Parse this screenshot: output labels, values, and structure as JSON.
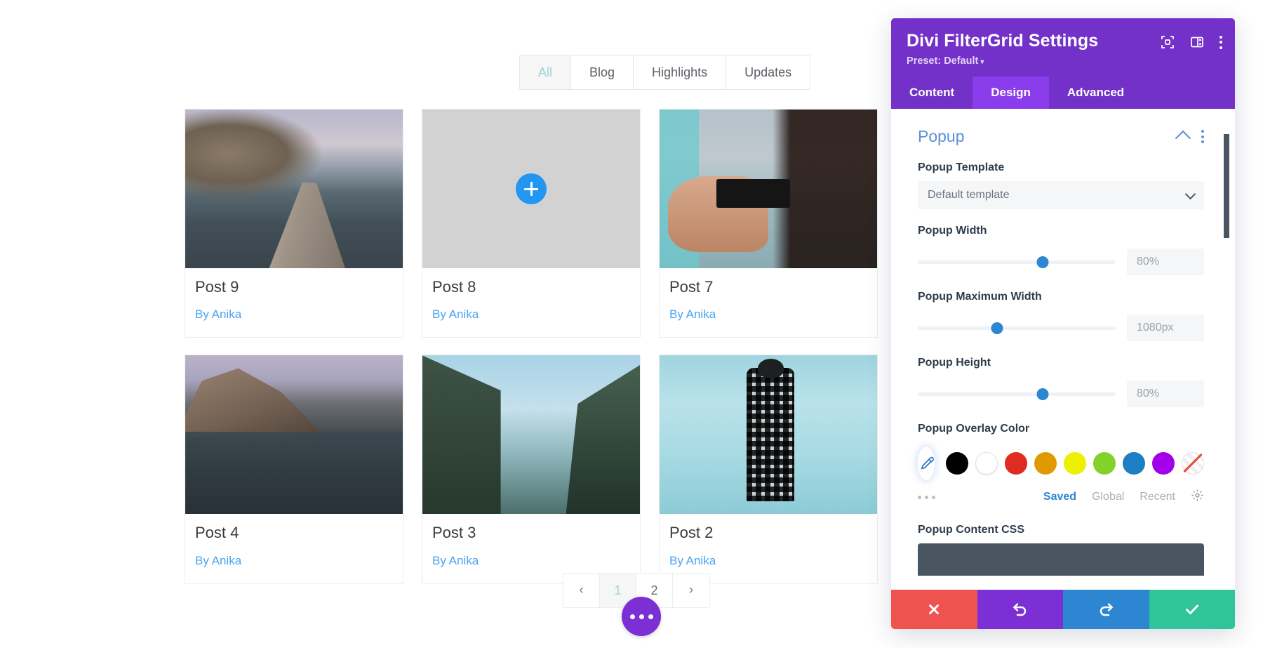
{
  "preview": {
    "filters": [
      {
        "label": "All",
        "active": true
      },
      {
        "label": "Blog",
        "active": false
      },
      {
        "label": "Highlights",
        "active": false
      },
      {
        "label": "Updates",
        "active": false
      }
    ],
    "posts": [
      {
        "title": "Post 9",
        "author": "By Anika",
        "hovered": false,
        "art": "ph-lake-dock"
      },
      {
        "title": "Post 8",
        "author": "By Anika",
        "hovered": true,
        "art": "ph-binocular"
      },
      {
        "title": "Post 7",
        "author": "By Anika",
        "hovered": false,
        "art": "ph-camera-hands"
      },
      {
        "title": "Post 4",
        "author": "By Anika",
        "hovered": false,
        "art": "ph-mountain-lake"
      },
      {
        "title": "Post 3",
        "author": "By Anika",
        "hovered": false,
        "art": "ph-louise"
      },
      {
        "title": "Post 2",
        "author": "By Anika",
        "hovered": false,
        "art": "ph-man"
      }
    ],
    "pagination": {
      "prev": "‹",
      "next": "›",
      "pages": [
        {
          "label": "1",
          "active": true
        },
        {
          "label": "2",
          "active": false
        }
      ]
    },
    "fab": "more-options-fab"
  },
  "panel": {
    "title": "Divi FilterGrid Settings",
    "preset": "Preset: Default",
    "preset_caret": "▾",
    "header_icons": [
      "focus-target-icon",
      "layout-panel-icon",
      "more-vertical-icon"
    ],
    "tabs": [
      {
        "label": "Content",
        "active": false
      },
      {
        "label": "Design",
        "active": true
      },
      {
        "label": "Advanced",
        "active": false
      }
    ],
    "section": {
      "title": "Popup",
      "collapse_icon": "chevron-up-icon",
      "menu_icon": "more-vertical-icon"
    },
    "fields": {
      "popup_template": {
        "label": "Popup Template",
        "value": "Default template"
      },
      "popup_width": {
        "label": "Popup Width",
        "value": "80%",
        "knob_percent": 63
      },
      "popup_max_width": {
        "label": "Popup Maximum Width",
        "value": "1080px",
        "knob_percent": 40
      },
      "popup_height": {
        "label": "Popup Height",
        "value": "80%",
        "knob_percent": 63
      },
      "popup_overlay_color": {
        "label": "Popup Overlay Color",
        "picker_icon": "eyedropper-icon",
        "swatches": [
          {
            "name": "black",
            "hex": "#000000"
          },
          {
            "name": "white",
            "hex": "#ffffff"
          },
          {
            "name": "red",
            "hex": "#e02b20"
          },
          {
            "name": "orange",
            "hex": "#e09900"
          },
          {
            "name": "yellow",
            "hex": "#edf000"
          },
          {
            "name": "green",
            "hex": "#82d22a"
          },
          {
            "name": "blue",
            "hex": "#1c7fc4"
          },
          {
            "name": "purple",
            "hex": "#a100e8"
          },
          {
            "name": "transparent",
            "hex": "none"
          }
        ],
        "more_icon": "more-horizontal-icon",
        "tabs": [
          {
            "label": "Saved",
            "active": true
          },
          {
            "label": "Global",
            "active": false
          },
          {
            "label": "Recent",
            "active": false
          }
        ],
        "settings_icon": "gear-icon"
      },
      "popup_content_css": {
        "label": "Popup Content CSS"
      }
    },
    "footer": [
      {
        "name": "cancel-button",
        "icon": "close-icon",
        "color": "#ef5350"
      },
      {
        "name": "undo-button",
        "icon": "undo-icon",
        "color": "#7b2fd4"
      },
      {
        "name": "redo-button",
        "icon": "redo-icon",
        "color": "#2d86d2"
      },
      {
        "name": "save-button",
        "icon": "check-icon",
        "color": "#2fc49a"
      }
    ]
  }
}
